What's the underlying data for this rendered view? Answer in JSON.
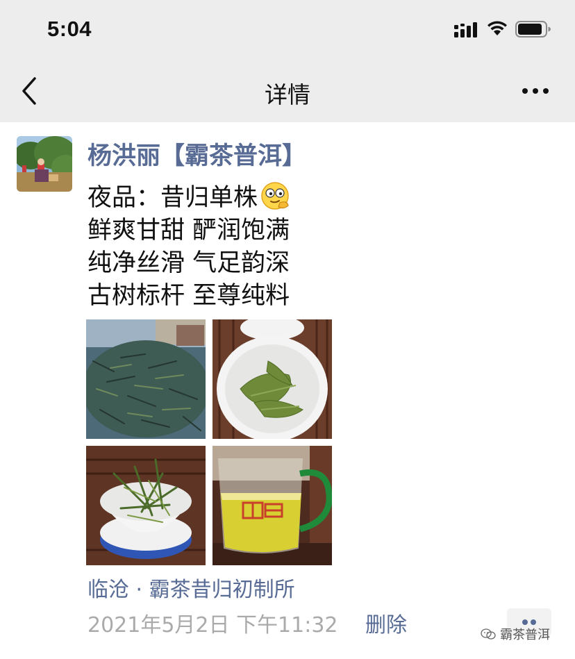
{
  "status_bar": {
    "time": "5:04"
  },
  "nav": {
    "title": "详情"
  },
  "post": {
    "author": "杨洪丽【霸茶普洱】",
    "lines": [
      "夜品：昔归单株",
      "鲜爽甘甜 酽润饱满",
      "纯净丝滑 气足韵深",
      "古树标杆 至尊纯料"
    ],
    "photos": [
      "tea-leaves-drying",
      "tea-in-white-cup",
      "tea-in-gaiwan",
      "tea-in-glass-pitcher"
    ],
    "location": "临沧 · 霸茶昔归初制所",
    "timestamp": "2021年5月2日 下午11:32",
    "delete_label": "删除"
  },
  "watermark": {
    "text": "霸茶普洱"
  },
  "colors": {
    "link_blue": "#576b95",
    "header_bg": "#ededed",
    "timestamp_grey": "#aaaaaa"
  }
}
